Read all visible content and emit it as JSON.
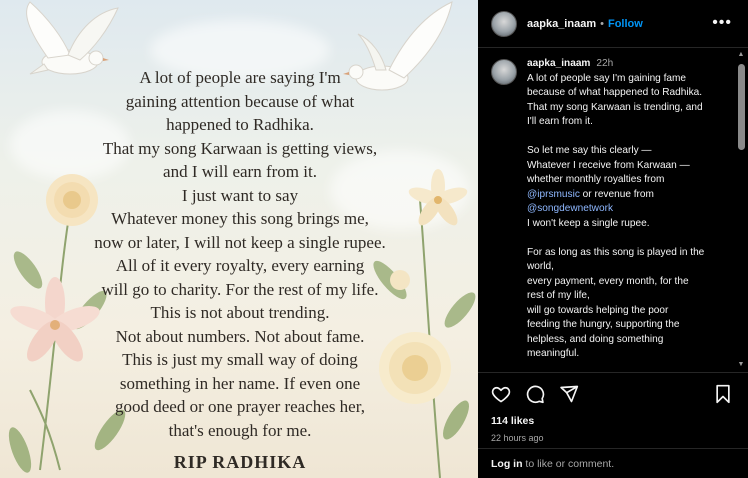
{
  "post": {
    "poem_lines": [
      "A lot of people are saying I'm",
      "gaining attention because of what",
      "happened to Radhika.",
      "That my song Karwaan is getting views,",
      "and I will earn from it.",
      "I just want to say",
      "Whatever money this song brings me,",
      "now or later, I will not keep a single rupee.",
      "All of it every royalty, every earning",
      "will go to charity. For the rest of my life.",
      "This is not about trending.",
      "Not about numbers. Not about fame.",
      "This is just my small way of doing",
      "something in her name. If even one",
      "good deed or one prayer reaches her,",
      "that's enough for me."
    ],
    "rip": "RIP RADHIKA"
  },
  "header": {
    "username": "aapka_inaam",
    "separator": "•",
    "follow": "Follow",
    "more": "•••"
  },
  "caption": {
    "username": "aapka_inaam",
    "time": "22h",
    "p1": [
      "A lot of people say I'm gaining fame",
      "because of what happened to Radhika.",
      "That my song Karwaan is trending, and",
      "I'll earn from it."
    ],
    "p2a": [
      "So let me say this clearly —",
      "Whatever I receive from Karwaan —",
      "whether monthly royalties from"
    ],
    "mention1": "@iprsmusic",
    "p2b": " or revenue from",
    "mention2": "@songdewnetwork",
    "p2c": "I won't keep a single rupee.",
    "p3": [
      "For as long as this song is played in the",
      "world,",
      "every payment, every month, for the",
      "rest of my life,",
      "will go towards helping the poor",
      "feeding the hungry, supporting the",
      "helpless, and doing something",
      "meaningful."
    ]
  },
  "scroll": {
    "up": "▲",
    "down": "▼"
  },
  "stats": {
    "likes": "114 likes",
    "ago": "22 hours ago"
  },
  "footer": {
    "login": "Log in",
    "rest": " to like or comment."
  },
  "colors": {
    "accent": "#0095f6",
    "mention": "#8fb8ff",
    "background": "#000000"
  }
}
